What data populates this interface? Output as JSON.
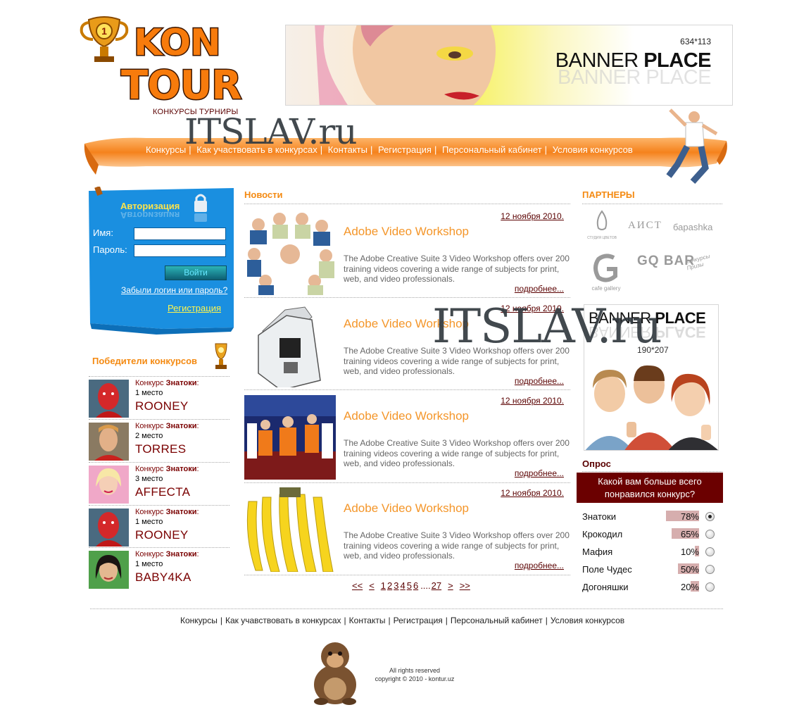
{
  "header": {
    "logo_line1": "KON",
    "logo_line2": "TOUR",
    "logo_badge": "1",
    "tagline": "КОНКУРСЫ ТУРНИРЫ",
    "banner_size": "634*113",
    "banner_text_a": "BANNER ",
    "banner_text_b": "PLACE",
    "banner_reflection": "BANNER PLACE"
  },
  "watermark": "ITSLAV.ru",
  "nav": {
    "items": [
      "Конкурсы",
      "Как участвовать в конкурсах",
      "Контакты",
      "Регистрация",
      "Персональный кабинет",
      "Условия конкурсов"
    ],
    "separator": "|"
  },
  "login": {
    "title": "Авторизация",
    "name_label": "Имя:",
    "password_label": "Пароль:",
    "name_value": "",
    "password_value": "",
    "button": "Войти",
    "forgot": "Забыли логин или пароль?",
    "register": "Регистрация"
  },
  "winners": {
    "title": "Победители конкурсов",
    "items": [
      {
        "contest_prefix": "Конкурс ",
        "contest_name": "Знатоки",
        "colon": ":",
        "place": "1 место",
        "nick": "ROONEY"
      },
      {
        "contest_prefix": "Конкурс ",
        "contest_name": "Знатоки",
        "colon": ":",
        "place": "2 место",
        "nick": "TORRES"
      },
      {
        "contest_prefix": "Конкурс ",
        "contest_name": "Знатоки",
        "colon": ":",
        "place": "3 место",
        "nick": "AFFECTA"
      },
      {
        "contest_prefix": "Конкурс ",
        "contest_name": "Знатоки",
        "colon": ":",
        "place": "1 место",
        "nick": "ROONEY"
      },
      {
        "contest_prefix": "Конкурс ",
        "contest_name": "Знатоки",
        "colon": ":",
        "place": "1 место",
        "nick": "BABY4KA"
      }
    ]
  },
  "news": {
    "title": "Новости",
    "items": [
      {
        "date": "12 ноября 2010.",
        "title": "Adobe Video Workshop",
        "text": "The Adobe Creative Suite 3 Video Workshop offers over 200 training videos covering a wide range of subjects for print, web, and video professionals.",
        "more": "подробнее..."
      },
      {
        "date": "12 ноября 2010.",
        "title": "Adobe Video Workshop",
        "text": "The Adobe Creative Suite 3 Video Workshop offers over 200 training videos covering a wide range of subjects for print, web, and video professionals.",
        "more": "подробнее..."
      },
      {
        "date": "12 ноября 2010.",
        "title": "Adobe Video Workshop",
        "text": "The Adobe Creative Suite 3 Video Workshop offers over 200 training videos covering a wide range of subjects for print, web, and video professionals.",
        "more": "подробнее..."
      },
      {
        "date": "12 ноября 2010.",
        "title": "Adobe Video Workshop",
        "text": "The Adobe Creative Suite 3 Video Workshop offers over 200 training videos covering a wide range of subjects for print, web, and video professionals.",
        "more": "подробнее..."
      }
    ],
    "pager": {
      "first": "<<",
      "prev": "<",
      "pages": [
        "1",
        "2",
        "3",
        "4",
        "5",
        "6"
      ],
      "ellipsis": "....",
      "last_page": "27",
      "next": ">",
      "last": ">>"
    }
  },
  "partners": {
    "title": "ПАРТНЕРЫ",
    "logos": [
      "СТУДИЯ ЦВЕТОВ",
      "АИСТ",
      "бараshka",
      "cafe gallery",
      "GQ BAR",
      "Конкурсы Призы"
    ]
  },
  "side_banner": {
    "text_a": "BANNER ",
    "text_b": "PLACE",
    "size": "190*207"
  },
  "poll": {
    "title": "Опрос",
    "question": "Какой вам больше всего понравился конкурс?",
    "options": [
      {
        "label": "Знатоки",
        "percent": "78%",
        "value": 78,
        "selected": true
      },
      {
        "label": "Крокодил",
        "percent": "65%",
        "value": 65,
        "selected": false
      },
      {
        "label": "Мафия",
        "percent": "10%",
        "value": 10,
        "selected": false
      },
      {
        "label": "Поле Чудес",
        "percent": "50%",
        "value": 50,
        "selected": false
      },
      {
        "label": "Догоняшки",
        "percent": "20%",
        "value": 20,
        "selected": false
      }
    ]
  },
  "footer": {
    "nav": [
      "Конкурсы",
      "Как учавствовать в конкурсах",
      "Контакты",
      "Регистрация",
      "Персональный кабинет",
      "Условия конкурсов"
    ],
    "separator": "|",
    "rights": "All rights reserved",
    "copyright": "copyright © 2010 - kontur.uz"
  },
  "colors": {
    "accent_orange": "#f48a12",
    "dark_red": "#6b0000",
    "login_blue": "#1a8fe0",
    "poll_bar": "#d6aeae"
  }
}
